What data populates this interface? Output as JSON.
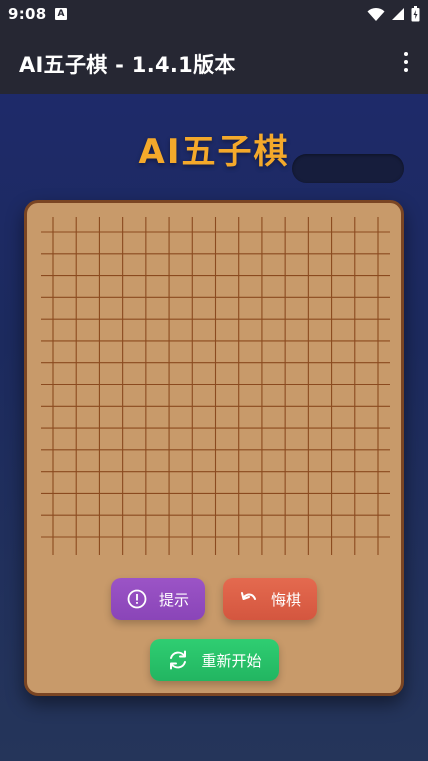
{
  "status_bar": {
    "time": "9:08",
    "notification_glyph": "A",
    "icons": [
      "wifi-icon",
      "signal-icon",
      "battery-icon"
    ]
  },
  "app_bar": {
    "title": "AI五子棋 - 1.4.1版本",
    "menu_icon": "more-vert-icon"
  },
  "header": {
    "game_title": "AI五子棋"
  },
  "board": {
    "lines": 15,
    "line_color": "#8b4a1f",
    "background": "#c89a6a"
  },
  "buttons": {
    "hint_label": "提示",
    "undo_label": "悔棋",
    "restart_label": "重新开始"
  },
  "colors": {
    "title": "#f4a92b",
    "hint": "#9b54c6",
    "undo": "#e46a4f",
    "restart": "#2fce72",
    "bar": "#262733"
  }
}
